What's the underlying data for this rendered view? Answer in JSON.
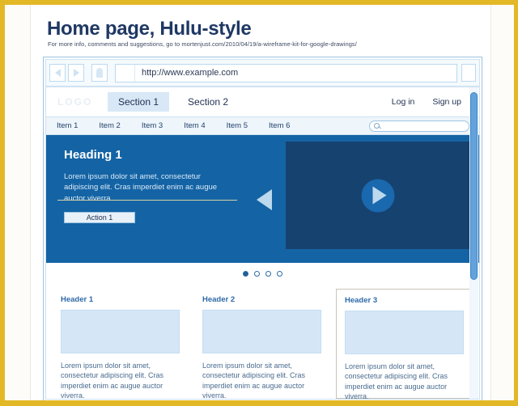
{
  "document": {
    "title": "Home page, Hulu-style",
    "subtitle": "For more info, comments and suggestions, go to mortenjust.com/2010/04/19/a-wireframe-kit-for-google-drawings/"
  },
  "browser": {
    "back_icon": "back-arrow-icon",
    "forward_icon": "forward-arrow-icon",
    "stop_icon": "stop-icon",
    "url_value": "http://www.example.com"
  },
  "site_header": {
    "logo": "LOGO",
    "sections": [
      {
        "label": "Section 1",
        "active": true
      },
      {
        "label": "Section 2",
        "active": false
      }
    ],
    "login_label": "Log in",
    "signup_label": "Sign up"
  },
  "subnav": {
    "items": [
      "Item 1",
      "Item 2",
      "Item 3",
      "Item 4",
      "Item 5",
      "Item 6"
    ],
    "search_icon": "search-icon",
    "search_value": ""
  },
  "hero": {
    "heading": "Heading 1",
    "body": "Lorem ipsum dolor sit amet, consectetur adipiscing elit. Cras imperdiet enim ac augue auctor viverra.",
    "action_label": "Action 1",
    "play_icon": "play-icon",
    "prev_icon": "carousel-prev-icon",
    "next_icon": "carousel-next-icon"
  },
  "carousel": {
    "dots": [
      true,
      false,
      false,
      false
    ]
  },
  "columns": [
    {
      "header": "Header 1",
      "body": "Lorem ipsum dolor sit amet, consectetur adipiscing elit. Cras imperdiet enim ac augue auctor viverra.",
      "selected": false
    },
    {
      "header": "Header 2",
      "body": "Lorem ipsum dolor sit amet, consectetur adipiscing elit. Cras imperdiet enim ac augue auctor viverra.",
      "selected": false
    },
    {
      "header": "Header 3",
      "body": "Lorem ipsum dolor sit amet, consectetur adipiscing elit. Cras imperdiet enim ac augue auctor viverra.",
      "selected": true
    }
  ],
  "colors": {
    "frame": "#e3b827",
    "hero_bg": "#1464a5",
    "video_bg": "#16426f",
    "accent_blue": "#2e6aa8",
    "title_navy": "#1f3864",
    "scrollbar": "#63a2dc"
  }
}
